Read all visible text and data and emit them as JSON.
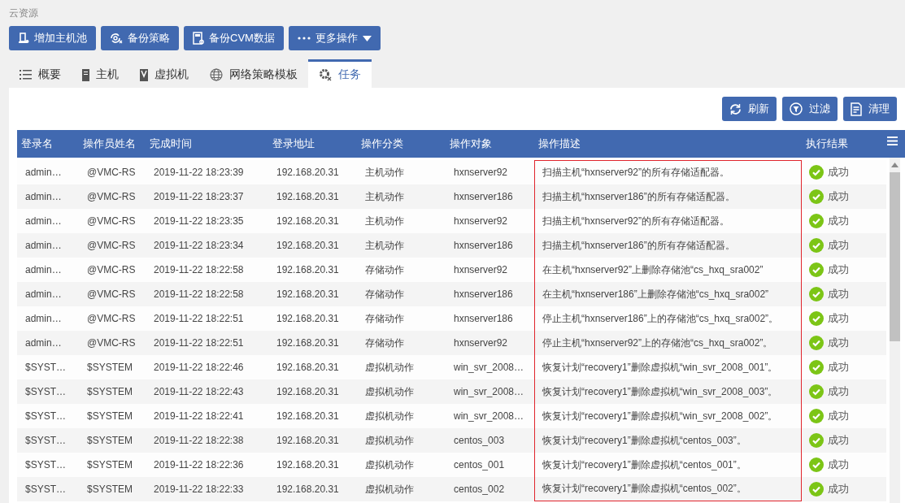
{
  "breadcrumb": "云资源",
  "actions": [
    {
      "label": "增加主机池"
    },
    {
      "label": "备份策略"
    },
    {
      "label": "备份CVM数据"
    },
    {
      "label": "更多操作"
    }
  ],
  "tabs": [
    {
      "label": "概要",
      "selected": false
    },
    {
      "label": "主机",
      "selected": false
    },
    {
      "label": "虚拟机",
      "selected": false
    },
    {
      "label": "网络策略模板",
      "selected": false
    },
    {
      "label": "任务",
      "selected": true
    }
  ],
  "toolbar": [
    {
      "label": "刷新"
    },
    {
      "label": "过滤"
    },
    {
      "label": "清理"
    }
  ],
  "annotation": {
    "kind": "frame"
  },
  "table": {
    "columns": [
      "登录名",
      "操作员姓名",
      "完成时间",
      "登录地址",
      "操作分类",
      "操作对象",
      "操作描述",
      "执行结果"
    ],
    "rows": [
      {
        "cells": [
          "admin…",
          "@VMC-RS",
          "2019-11-22 18:23:39",
          "192.168.20.31",
          "主机动作",
          "hxnserver92",
          "扫描主机“hxnserver92”的所有存储适配器。"
        ],
        "result": "成功"
      },
      {
        "cells": [
          "admin…",
          "@VMC-RS",
          "2019-11-22 18:23:37",
          "192.168.20.31",
          "主机动作",
          "hxnserver186",
          "扫描主机“hxnserver186”的所有存储适配器。"
        ],
        "result": "成功"
      },
      {
        "cells": [
          "admin…",
          "@VMC-RS",
          "2019-11-22 18:23:35",
          "192.168.20.31",
          "主机动作",
          "hxnserver92",
          "扫描主机“hxnserver92”的所有存储适配器。"
        ],
        "result": "成功"
      },
      {
        "cells": [
          "admin…",
          "@VMC-RS",
          "2019-11-22 18:23:34",
          "192.168.20.31",
          "主机动作",
          "hxnserver186",
          "扫描主机“hxnserver186”的所有存储适配器。"
        ],
        "result": "成功"
      },
      {
        "cells": [
          "admin…",
          "@VMC-RS",
          "2019-11-22 18:22:58",
          "192.168.20.31",
          "存储动作",
          "hxnserver92",
          "在主机“hxnserver92”上删除存储池“cs_hxq_sra002”"
        ],
        "result": "成功"
      },
      {
        "cells": [
          "admin…",
          "@VMC-RS",
          "2019-11-22 18:22:58",
          "192.168.20.31",
          "存储动作",
          "hxnserver186",
          "在主机“hxnserver186”上删除存储池“cs_hxq_sra002”"
        ],
        "result": "成功"
      },
      {
        "cells": [
          "admin…",
          "@VMC-RS",
          "2019-11-22 18:22:51",
          "192.168.20.31",
          "存储动作",
          "hxnserver186",
          "停止主机“hxnserver186”上的存储池“cs_hxq_sra002”。"
        ],
        "result": "成功"
      },
      {
        "cells": [
          "admin…",
          "@VMC-RS",
          "2019-11-22 18:22:51",
          "192.168.20.31",
          "存储动作",
          "hxnserver92",
          "停止主机“hxnserver92”上的存储池“cs_hxq_sra002”。"
        ],
        "result": "成功"
      },
      {
        "cells": [
          "$SYST…",
          "$SYSTEM",
          "2019-11-22 18:22:46",
          "192.168.20.31",
          "虚拟机动作",
          "win_svr_2008…",
          "恢复计划“recovery1”删除虚拟机“win_svr_2008_001”。"
        ],
        "result": "成功"
      },
      {
        "cells": [
          "$SYST…",
          "$SYSTEM",
          "2019-11-22 18:22:43",
          "192.168.20.31",
          "虚拟机动作",
          "win_svr_2008…",
          "恢复计划“recovery1”删除虚拟机“win_svr_2008_003”。"
        ],
        "result": "成功"
      },
      {
        "cells": [
          "$SYST…",
          "$SYSTEM",
          "2019-11-22 18:22:41",
          "192.168.20.31",
          "虚拟机动作",
          "win_svr_2008…",
          "恢复计划“recovery1”删除虚拟机“win_svr_2008_002”。"
        ],
        "result": "成功"
      },
      {
        "cells": [
          "$SYST…",
          "$SYSTEM",
          "2019-11-22 18:22:38",
          "192.168.20.31",
          "虚拟机动作",
          "centos_003",
          "恢复计划“recovery1”删除虚拟机“centos_003”。"
        ],
        "result": "成功"
      },
      {
        "cells": [
          "$SYST…",
          "$SYSTEM",
          "2019-11-22 18:22:36",
          "192.168.20.31",
          "虚拟机动作",
          "centos_001",
          "恢复计划“recovery1”删除虚拟机“centos_001”。"
        ],
        "result": "成功"
      },
      {
        "cells": [
          "$SYST…",
          "$SYSTEM",
          "2019-11-22 18:22:33",
          "192.168.20.31",
          "虚拟机动作",
          "centos_002",
          "恢复计划“recovery1”删除虚拟机“centos_002”。"
        ],
        "result": "成功"
      }
    ]
  }
}
